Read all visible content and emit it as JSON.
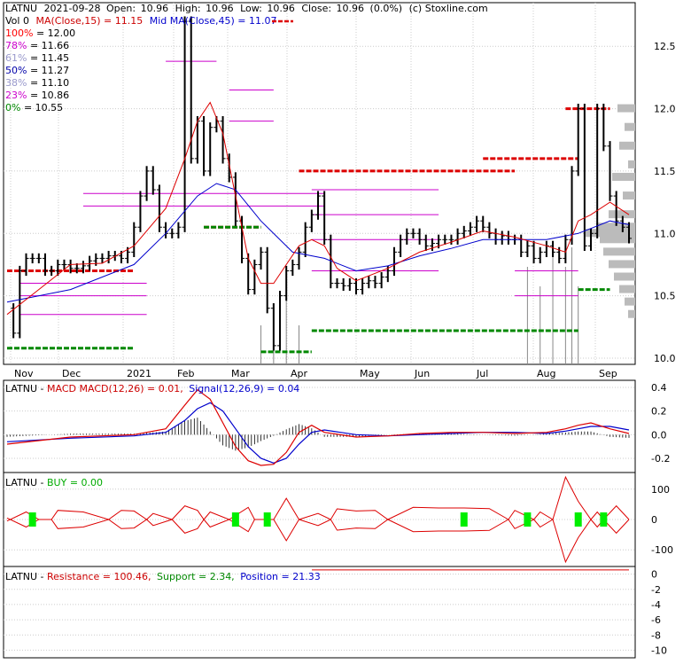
{
  "header": {
    "symbol": "LATNU",
    "date": "2021-09-28",
    "open_label": "Open:",
    "open": "10.96",
    "high_label": "High:",
    "high": "10.96",
    "low_label": "Low:",
    "low": "10.96",
    "close_label": "Close:",
    "close": "10.96",
    "change": "(0.0%)",
    "credit": "(c) Stoxline.com"
  },
  "legend": {
    "vol_label": "Vol 0",
    "ma15_label": "MA(Close,15) = 11.15",
    "ma45_label": "Mid MA(Close,45) = 11.07"
  },
  "colors": {
    "price_bar": "#000000",
    "ma15": "#dd0000",
    "ma45": "#0000cc",
    "resistance_line": "#dd0000",
    "support_line": "#008800",
    "fib_line": "#cc00cc",
    "volume_bar": "#888888",
    "volume_profile": "#bbbbbb",
    "macd": "#dd0000",
    "signal": "#0000cc",
    "histogram": "#000000",
    "buy_marker": "#00ee00",
    "grid": "#cccccc",
    "border": "#000000"
  },
  "chart_data": [
    {
      "type": "candlestick",
      "panel": "price",
      "yticks": [
        "12.5",
        "12.0",
        "11.5",
        "11.0",
        "10.5",
        "10.0"
      ],
      "ylim": [
        9.95,
        12.85
      ],
      "xticks": [
        "Nov",
        "Dec",
        "2021",
        "Feb",
        "Mar",
        "Apr",
        "May",
        "Jun",
        "Jul",
        "Aug",
        "Sep"
      ],
      "fib_levels": [
        {
          "pct": "100%",
          "value": "12.00",
          "color": "#ff0000"
        },
        {
          "pct": "78%",
          "value": "11.66",
          "color": "#cc00cc"
        },
        {
          "pct": "61%",
          "value": "11.45",
          "color": "#9999cc"
        },
        {
          "pct": "50%",
          "value": "11.27",
          "color": "#0000aa"
        },
        {
          "pct": "38%",
          "value": "11.10",
          "color": "#9999cc"
        },
        {
          "pct": "23%",
          "value": "10.86",
          "color": "#cc00cc"
        },
        {
          "pct": "0%",
          "value": "10.55",
          "color": "#008800"
        }
      ],
      "price_polyline": [
        [
          0,
          10.4
        ],
        [
          1,
          10.2
        ],
        [
          2,
          10.7
        ],
        [
          3,
          10.8
        ],
        [
          4,
          10.8
        ],
        [
          5,
          10.8
        ],
        [
          6,
          10.7
        ],
        [
          7,
          10.7
        ],
        [
          8,
          10.75
        ],
        [
          9,
          10.75
        ],
        [
          10,
          10.72
        ],
        [
          11,
          10.72
        ],
        [
          12,
          10.74
        ],
        [
          13,
          10.78
        ],
        [
          14,
          10.8
        ],
        [
          15,
          10.8
        ],
        [
          16,
          10.82
        ],
        [
          17,
          10.82
        ],
        [
          18,
          10.8
        ],
        [
          19,
          10.85
        ],
        [
          20,
          11.05
        ],
        [
          21,
          11.3
        ],
        [
          22,
          11.5
        ],
        [
          23,
          11.35
        ],
        [
          24,
          11.05
        ],
        [
          25,
          11.0
        ],
        [
          26,
          11.0
        ],
        [
          27,
          11.05
        ],
        [
          28,
          12.7
        ],
        [
          29,
          11.6
        ],
        [
          30,
          11.9
        ],
        [
          31,
          11.5
        ],
        [
          32,
          11.85
        ],
        [
          33,
          11.9
        ],
        [
          34,
          11.6
        ],
        [
          35,
          11.45
        ],
        [
          36,
          11.1
        ],
        [
          37,
          10.8
        ],
        [
          38,
          10.55
        ],
        [
          39,
          10.75
        ],
        [
          40,
          10.85
        ],
        [
          41,
          10.4
        ],
        [
          42,
          10.1
        ],
        [
          43,
          10.5
        ],
        [
          44,
          10.7
        ],
        [
          45,
          10.75
        ],
        [
          46,
          10.85
        ],
        [
          47,
          11.05
        ],
        [
          48,
          11.15
        ],
        [
          49,
          11.3
        ],
        [
          50,
          10.95
        ],
        [
          51,
          10.6
        ],
        [
          52,
          10.6
        ],
        [
          53,
          10.58
        ],
        [
          54,
          10.6
        ],
        [
          55,
          10.55
        ],
        [
          56,
          10.6
        ],
        [
          57,
          10.62
        ],
        [
          58,
          10.6
        ],
        [
          59,
          10.65
        ],
        [
          60,
          10.7
        ],
        [
          61,
          10.85
        ],
        [
          62,
          10.95
        ],
        [
          63,
          11.0
        ],
        [
          64,
          11.0
        ],
        [
          65,
          10.95
        ],
        [
          66,
          10.9
        ],
        [
          67,
          10.92
        ],
        [
          68,
          10.95
        ],
        [
          69,
          10.95
        ],
        [
          70,
          10.95
        ],
        [
          71,
          11.0
        ],
        [
          72,
          11.02
        ],
        [
          73,
          11.05
        ],
        [
          74,
          11.1
        ],
        [
          75,
          11.05
        ],
        [
          76,
          11.0
        ],
        [
          77,
          10.95
        ],
        [
          78,
          10.98
        ],
        [
          79,
          10.95
        ],
        [
          80,
          10.95
        ],
        [
          81,
          10.85
        ],
        [
          82,
          10.9
        ],
        [
          83,
          10.8
        ],
        [
          84,
          10.85
        ],
        [
          85,
          10.9
        ],
        [
          86,
          10.85
        ],
        [
          87,
          10.8
        ],
        [
          88,
          10.95
        ],
        [
          89,
          11.5
        ],
        [
          90,
          12.0
        ],
        [
          91,
          10.9
        ],
        [
          92,
          11.0
        ],
        [
          93,
          12.0
        ],
        [
          94,
          11.7
        ],
        [
          95,
          11.3
        ],
        [
          96,
          11.1
        ],
        [
          97,
          11.05
        ],
        [
          98,
          10.96
        ]
      ],
      "ma15": [
        [
          0,
          10.35
        ],
        [
          5,
          10.55
        ],
        [
          10,
          10.75
        ],
        [
          15,
          10.76
        ],
        [
          20,
          10.9
        ],
        [
          25,
          11.2
        ],
        [
          28,
          11.6
        ],
        [
          30,
          11.9
        ],
        [
          32,
          12.05
        ],
        [
          34,
          11.8
        ],
        [
          36,
          11.3
        ],
        [
          38,
          10.8
        ],
        [
          40,
          10.6
        ],
        [
          42,
          10.6
        ],
        [
          44,
          10.75
        ],
        [
          46,
          10.9
        ],
        [
          48,
          10.95
        ],
        [
          50,
          10.9
        ],
        [
          52,
          10.72
        ],
        [
          55,
          10.62
        ],
        [
          60,
          10.72
        ],
        [
          65,
          10.85
        ],
        [
          70,
          10.93
        ],
        [
          75,
          11.02
        ],
        [
          80,
          10.97
        ],
        [
          85,
          10.9
        ],
        [
          88,
          10.85
        ],
        [
          90,
          11.1
        ],
        [
          92,
          11.15
        ],
        [
          95,
          11.25
        ],
        [
          98,
          11.15
        ]
      ],
      "ma45": [
        [
          0,
          10.45
        ],
        [
          10,
          10.55
        ],
        [
          15,
          10.65
        ],
        [
          20,
          10.75
        ],
        [
          25,
          11.0
        ],
        [
          30,
          11.3
        ],
        [
          33,
          11.4
        ],
        [
          36,
          11.35
        ],
        [
          40,
          11.1
        ],
        [
          45,
          10.85
        ],
        [
          50,
          10.8
        ],
        [
          55,
          10.7
        ],
        [
          60,
          10.74
        ],
        [
          65,
          10.82
        ],
        [
          70,
          10.88
        ],
        [
          75,
          10.95
        ],
        [
          80,
          10.95
        ],
        [
          85,
          10.95
        ],
        [
          90,
          11.0
        ],
        [
          95,
          11.1
        ],
        [
          98,
          11.07
        ]
      ],
      "resistance_segments": [
        [
          0,
          20,
          10.7
        ],
        [
          31,
          40,
          11.05
        ],
        [
          46,
          80,
          11.5
        ],
        [
          75,
          90,
          11.6
        ],
        [
          88,
          95,
          12.0
        ]
      ],
      "support_segments": [
        [
          0,
          20,
          10.08
        ],
        [
          31,
          40,
          11.05
        ],
        [
          40,
          48,
          10.05
        ],
        [
          48,
          90,
          10.22
        ],
        [
          90,
          95,
          10.55
        ]
      ],
      "volume_spikes": [
        [
          40,
          2
        ],
        [
          42,
          3
        ],
        [
          44,
          4
        ],
        [
          46,
          2
        ],
        [
          82,
          5
        ],
        [
          84,
          4
        ],
        [
          86,
          6
        ],
        [
          88,
          5
        ],
        [
          89,
          6
        ],
        [
          90,
          4
        ]
      ]
    },
    {
      "type": "line",
      "panel": "macd",
      "title_prefix": "LATNU - ",
      "macd_label": "MACD",
      "macd_value_label": "MACD(12,26) = 0.01,",
      "signal_label": "Signal(12,26,9) = 0.04",
      "yticks": [
        "0.4",
        "0.2",
        "0.0",
        "-0.2"
      ],
      "ylim": [
        -0.32,
        0.46
      ],
      "macd": [
        [
          0,
          -0.08
        ],
        [
          10,
          -0.02
        ],
        [
          20,
          0.0
        ],
        [
          25,
          0.05
        ],
        [
          28,
          0.25
        ],
        [
          30,
          0.38
        ],
        [
          32,
          0.3
        ],
        [
          34,
          0.1
        ],
        [
          36,
          -0.1
        ],
        [
          38,
          -0.22
        ],
        [
          40,
          -0.26
        ],
        [
          42,
          -0.25
        ],
        [
          44,
          -0.15
        ],
        [
          46,
          0.02
        ],
        [
          48,
          0.08
        ],
        [
          50,
          0.02
        ],
        [
          55,
          -0.02
        ],
        [
          60,
          -0.01
        ],
        [
          65,
          0.01
        ],
        [
          70,
          0.02
        ],
        [
          75,
          0.02
        ],
        [
          80,
          0.01
        ],
        [
          85,
          0.02
        ],
        [
          88,
          0.05
        ],
        [
          90,
          0.08
        ],
        [
          92,
          0.1
        ],
        [
          95,
          0.05
        ],
        [
          98,
          0.01
        ]
      ],
      "signal": [
        [
          0,
          -0.06
        ],
        [
          10,
          -0.03
        ],
        [
          20,
          -0.01
        ],
        [
          25,
          0.02
        ],
        [
          28,
          0.12
        ],
        [
          30,
          0.22
        ],
        [
          32,
          0.27
        ],
        [
          34,
          0.2
        ],
        [
          36,
          0.05
        ],
        [
          38,
          -0.1
        ],
        [
          40,
          -0.2
        ],
        [
          42,
          -0.24
        ],
        [
          44,
          -0.2
        ],
        [
          46,
          -0.08
        ],
        [
          48,
          0.02
        ],
        [
          50,
          0.04
        ],
        [
          55,
          0.0
        ],
        [
          60,
          -0.01
        ],
        [
          65,
          0.0
        ],
        [
          70,
          0.01
        ],
        [
          75,
          0.02
        ],
        [
          80,
          0.02
        ],
        [
          85,
          0.01
        ],
        [
          88,
          0.03
        ],
        [
          90,
          0.05
        ],
        [
          92,
          0.07
        ],
        [
          95,
          0.07
        ],
        [
          98,
          0.04
        ]
      ]
    },
    {
      "type": "line",
      "panel": "buy",
      "title_prefix": "LATNU - ",
      "buy_label": "BUY = 0.00",
      "yticks": [
        "100",
        "0",
        "-100"
      ],
      "ylim": [
        -155,
        155
      ],
      "envelope": [
        [
          0,
          -5
        ],
        [
          3,
          25
        ],
        [
          5,
          0
        ],
        [
          7,
          0
        ],
        [
          8,
          30
        ],
        [
          12,
          25
        ],
        [
          16,
          0
        ],
        [
          18,
          30
        ],
        [
          20,
          28
        ],
        [
          22,
          0
        ],
        [
          23,
          20
        ],
        [
          26,
          0
        ],
        [
          28,
          45
        ],
        [
          30,
          30
        ],
        [
          31,
          0
        ],
        [
          32,
          25
        ],
        [
          35,
          0
        ],
        [
          38,
          40
        ],
        [
          39,
          0
        ],
        [
          42,
          0
        ],
        [
          44,
          70
        ],
        [
          46,
          0
        ],
        [
          49,
          20
        ],
        [
          51,
          0
        ],
        [
          52,
          35
        ],
        [
          55,
          28
        ],
        [
          58,
          30
        ],
        [
          60,
          0
        ],
        [
          64,
          40
        ],
        [
          68,
          38
        ],
        [
          72,
          38
        ],
        [
          76,
          36
        ],
        [
          79,
          0
        ],
        [
          80,
          30
        ],
        [
          83,
          0
        ],
        [
          84,
          25
        ],
        [
          86,
          0
        ],
        [
          88,
          140
        ],
        [
          90,
          60
        ],
        [
          92,
          0
        ],
        [
          93,
          25
        ],
        [
          94,
          0
        ],
        [
          96,
          45
        ],
        [
          98,
          0
        ]
      ],
      "buy_markers": [
        4,
        36,
        41,
        72,
        82,
        90,
        94
      ]
    },
    {
      "type": "line",
      "panel": "position",
      "title_prefix": "LATNU - ",
      "resistance_label": "Resistance = 100.46,",
      "support_label": "Support = 2.34,",
      "position_label": "Position = 21.33",
      "yticks": [
        "0",
        "-2",
        "-4",
        "-6",
        "-8",
        "-10"
      ],
      "ylim": [
        -11,
        1
      ]
    }
  ]
}
